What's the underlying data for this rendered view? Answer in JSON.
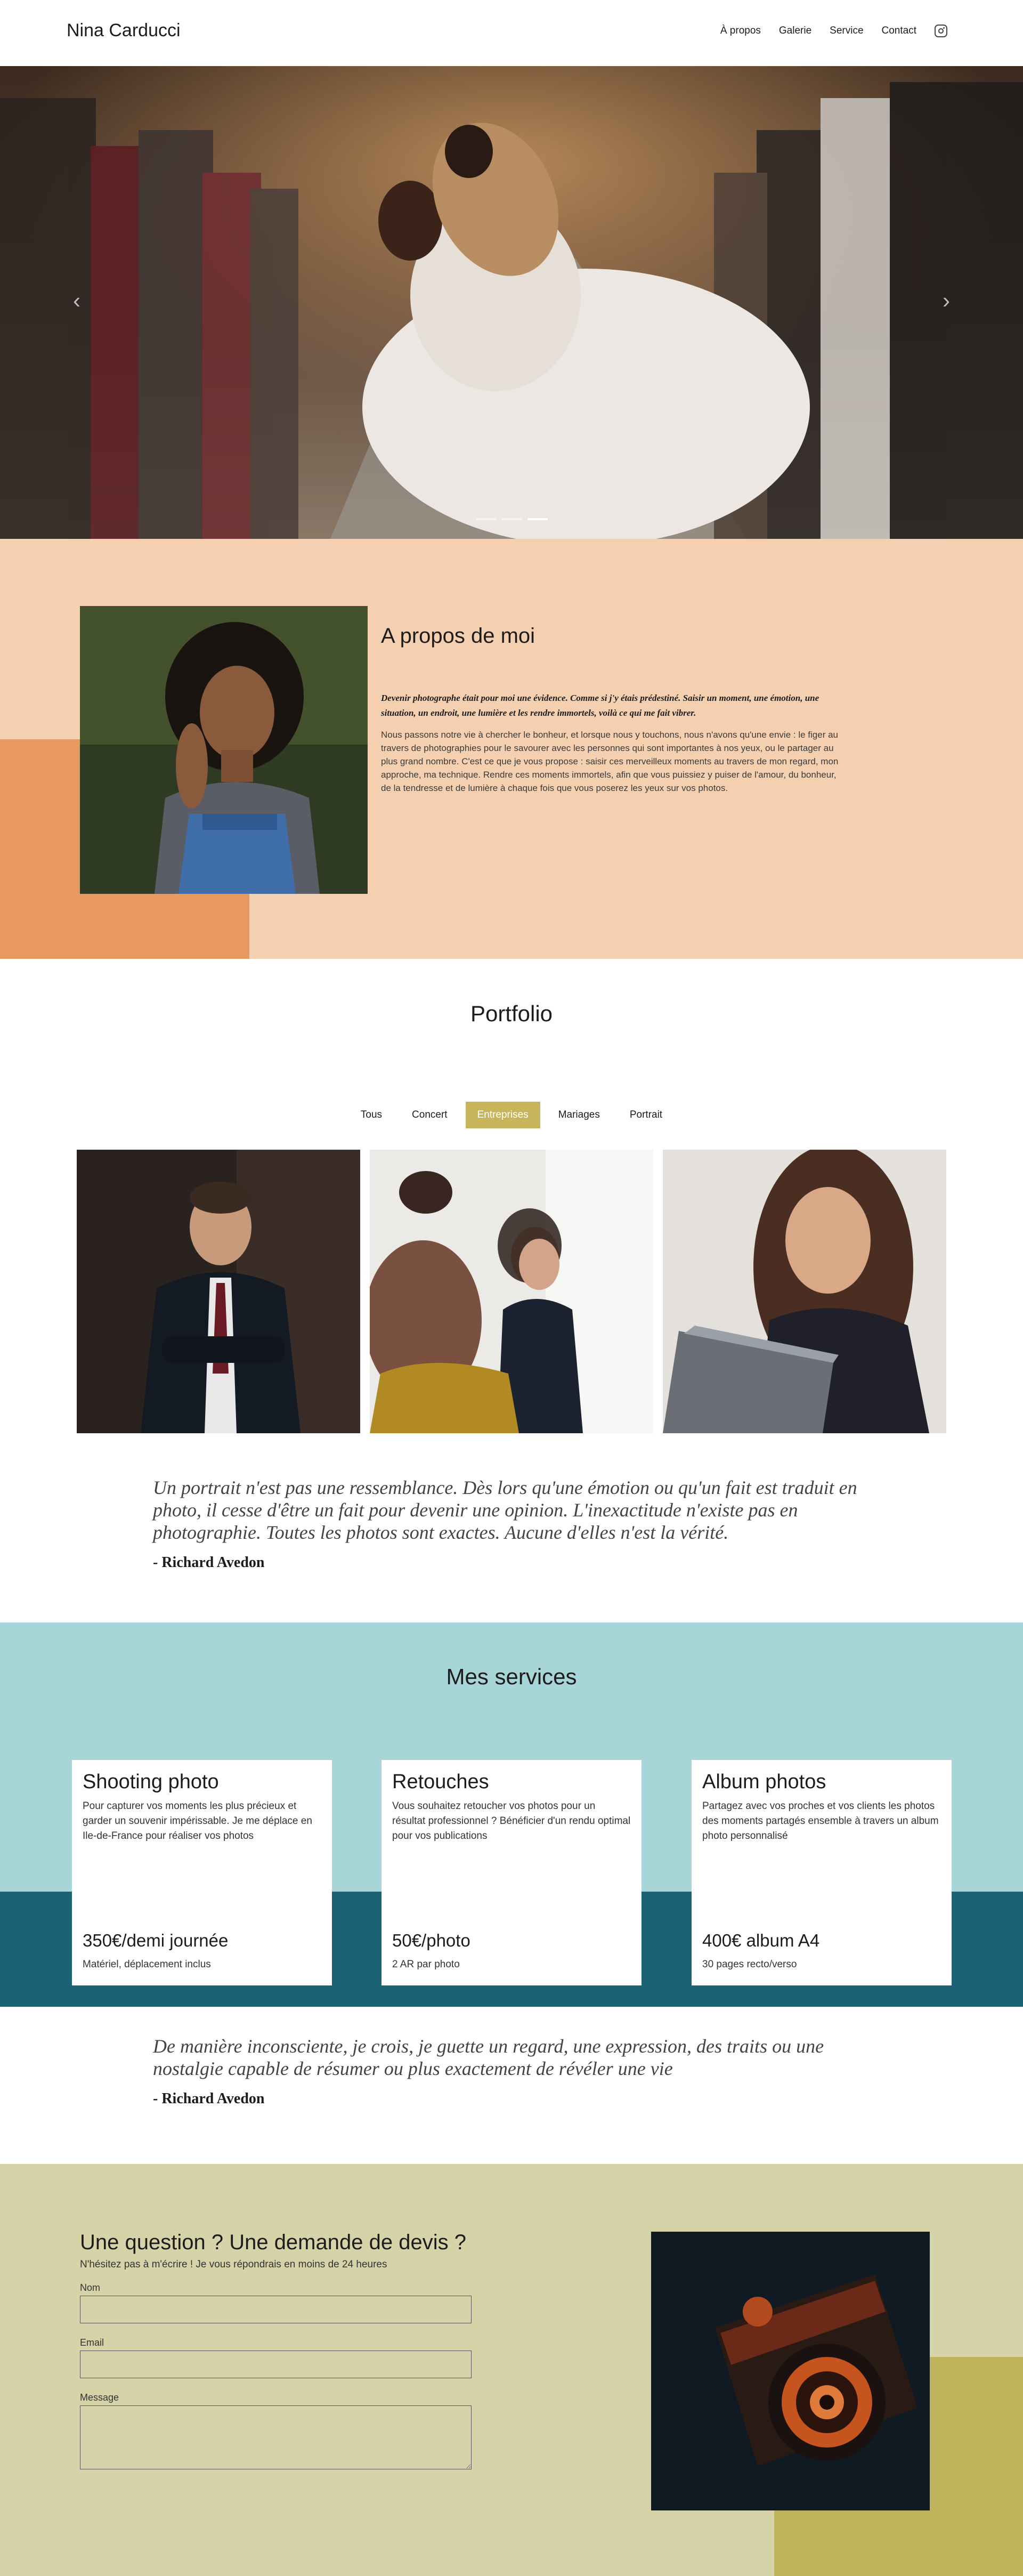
{
  "header": {
    "brand": "Nina Carducci",
    "nav": [
      "À propos",
      "Galerie",
      "Service",
      "Contact"
    ],
    "instagram_icon": "instagram-icon"
  },
  "hero": {
    "prev_icon": "chevron-left-icon",
    "next_icon": "chevron-right-icon",
    "slides": 3,
    "active_slide": 3
  },
  "about": {
    "title": "A propos de moi",
    "lead": "Devenir photographe était pour moi une évidence. Comme si j'y étais prédestiné. Saisir un moment, une émotion, une situation, un endroit, une lumière et les rendre immortels, voilà ce qui me fait vibrer.",
    "body": "Nous passons notre vie à chercher le bonheur, et lorsque nous y touchons, nous n'avons qu'une envie : le figer au travers de photographies pour le savourer avec les personnes qui sont importantes à nos yeux, ou le partager au plus grand nombre. C'est ce que je vous propose : saisir ces merveilleux moments au travers de mon regard, mon approche, ma technique. Rendre ces moments immortels, afin que vous puissiez y puiser de l'amour, du bonheur, de la tendresse et de lumière à chaque fois que vous poserez les yeux sur vos photos."
  },
  "portfolio": {
    "title": "Portfolio",
    "filters": [
      "Tous",
      "Concert",
      "Entreprises",
      "Mariages",
      "Portrait"
    ],
    "active_filter": "Entreprises"
  },
  "quote1": {
    "text": "Un portrait n'est pas une ressemblance. Dès lors qu'une émotion ou qu'un fait est traduit en photo, il cesse d'être un fait pour devenir une opinion. L'inexactitude n'existe pas en photographie. Toutes les photos sont exactes. Aucune d'elles n'est la vérité.",
    "author": "- Richard Avedon"
  },
  "services": {
    "title": "Mes services",
    "cards": [
      {
        "title": "Shooting photo",
        "desc": "Pour capturer vos moments les plus précieux et garder un souvenir impérissable. Je me déplace en Ile-de-France pour réaliser vos photos",
        "price": "350€/demi journée",
        "note": "Matériel, déplacement inclus"
      },
      {
        "title": "Retouches",
        "desc": "Vous souhaitez retoucher vos photos pour un résultat professionnel ? Bénéficier d'un rendu optimal pour vos publications",
        "price": "50€/photo",
        "note": "2 AR par photo"
      },
      {
        "title": "Album photos",
        "desc": "Partagez avec vos proches et vos clients les photos des moments partagés ensemble à travers un album photo personnalisé",
        "price": "400€ album A4",
        "note": "30 pages recto/verso"
      }
    ]
  },
  "quote2": {
    "text": "De manière inconsciente, je crois, je guette un regard, une expression, des traits ou une nostalgie capable de résumer ou plus exactement de révéler une vie",
    "author": "- Richard Avedon"
  },
  "contact": {
    "title": "Une question ? Une demande de devis ?",
    "subtitle": "N'hésitez pas à m'écrire ! Je vous répondrais en moins de 24 heures",
    "fields": {
      "name": "Nom",
      "email": "Email",
      "message": "Message"
    }
  },
  "colors": {
    "about_bg": "#f4d0b1",
    "about_accent": "#e89960",
    "filter_active": "#c6b55b",
    "services_bg": "#a8d5d7",
    "services_band": "#1b6274",
    "contact_bg": "#d6d3a8",
    "contact_accent": "#c0b45a"
  }
}
